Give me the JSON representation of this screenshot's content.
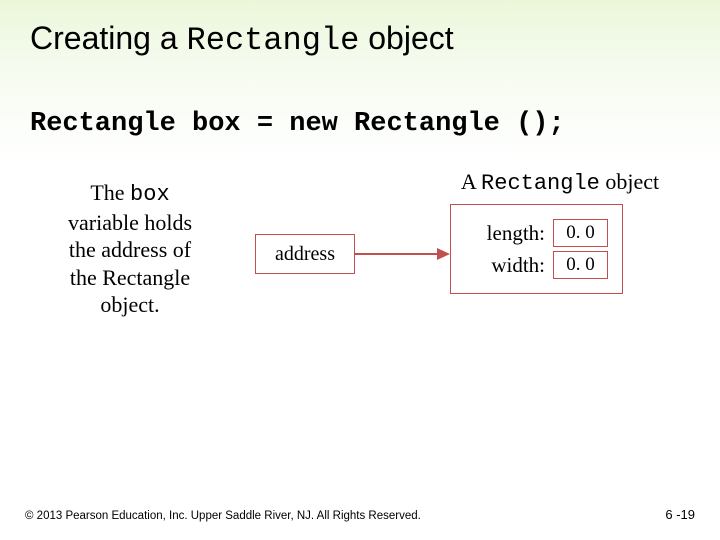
{
  "title": {
    "pre": "Creating a ",
    "code": "Rectangle",
    "post": " object"
  },
  "code_line": "Rectangle box = new Rectangle ();",
  "caption_left": {
    "l1a": "The ",
    "l1b": "box",
    "l2": "variable holds",
    "l3": "the address of",
    "l4": "the Rectangle",
    "l5": "object."
  },
  "address_label": "address",
  "caption_right": {
    "pre": "A ",
    "code": "Rectangle",
    "post": " object"
  },
  "object": {
    "length_label": "length:",
    "length_value": "0. 0",
    "width_label": "width:",
    "width_value": "0. 0"
  },
  "footer_left": "© 2013 Pearson Education, Inc. Upper Saddle River, NJ. All Rights Reserved.",
  "footer_right": "6 -19"
}
